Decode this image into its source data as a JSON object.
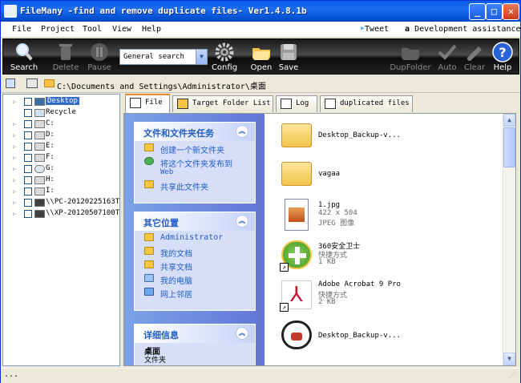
{
  "window": {
    "title": "FileMany -find and remove duplicate files- Ver1.4.8.1b",
    "controls": [
      "_",
      "□",
      "✕"
    ]
  },
  "menu": {
    "items": [
      "File",
      "Project",
      "Tool",
      "View",
      "Help"
    ],
    "tweet": "Tweet",
    "dev": "Development assistance"
  },
  "toolbar": {
    "search": "Search",
    "delete": "Delete",
    "pause": "Pause",
    "search_mode": "General search",
    "config": "Config",
    "open": "Open",
    "save": "Save",
    "dupfolder": "DupFolder",
    "auto": "Auto",
    "clear": "Clear",
    "help": "Help"
  },
  "address": {
    "path": "C:\\Documents and Settings\\Administrator\\桌面"
  },
  "tree": {
    "items": [
      "Desktop",
      "Recycle",
      "C:",
      "D:",
      "E:",
      "F:",
      "G:",
      "H:",
      "I:",
      "\\\\PC-20120225163T",
      "\\\\XP-20120507100T"
    ]
  },
  "tabs": [
    "File",
    "Target Folder List",
    "Log",
    "duplicated files"
  ],
  "taskpane": {
    "file_tasks": {
      "title": "文件和文件夹任务",
      "items": [
        "创建一个新文件夹",
        "将这个文件夹发布到",
        "Web",
        "共享此文件夹"
      ]
    },
    "other_places": {
      "title": "其它位置",
      "items": [
        "Administrator",
        "我的文档",
        "共享文档",
        "我的电脑",
        "网上邻居"
      ]
    },
    "details": {
      "title": "详细信息",
      "name": "桌面",
      "type": "文件夹"
    }
  },
  "files": [
    {
      "name": "Desktop_Backup-v...",
      "line2": "",
      "line3": ""
    },
    {
      "name": "vagaa",
      "line2": "",
      "line3": ""
    },
    {
      "name": "1.jpg",
      "line2": "422 x 504",
      "line3": "JPEG 图像"
    },
    {
      "name": "360安全卫士",
      "line2": "快捷方式",
      "line3": "1 KB"
    },
    {
      "name": "Adobe Acrobat 9 Pro",
      "line2": "快捷方式",
      "line3": "2 KB"
    },
    {
      "name": "Desktop_Backup-v...",
      "line2": "",
      "line3": ""
    }
  ],
  "status": {
    "text": "..."
  }
}
